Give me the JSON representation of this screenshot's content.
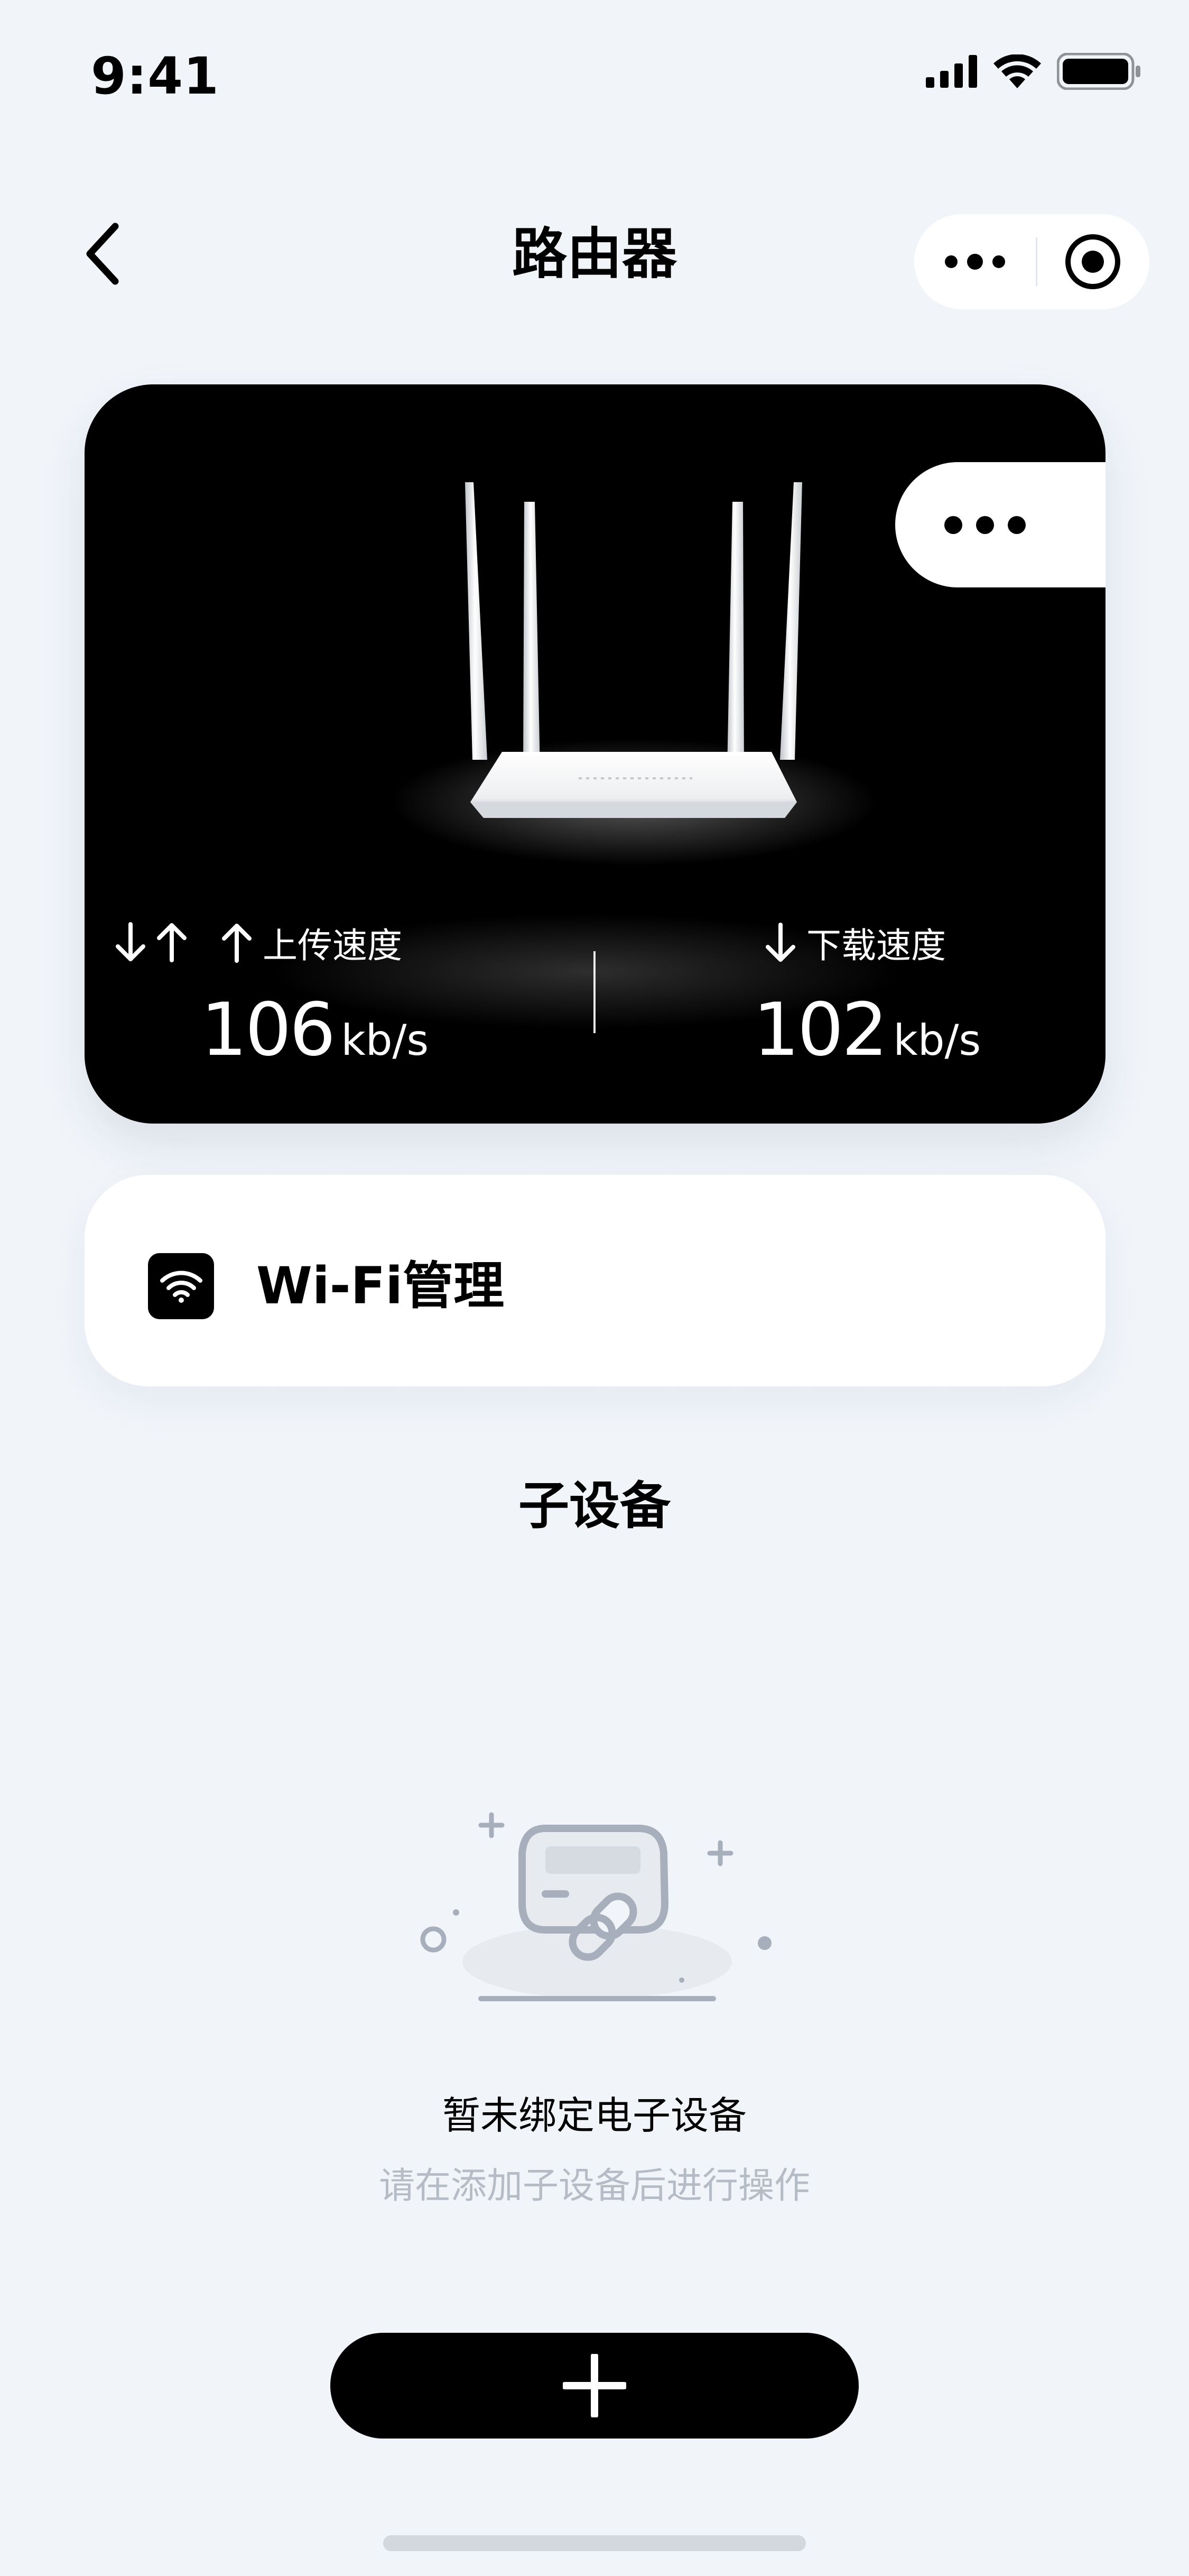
{
  "status_bar": {
    "time": "9:41",
    "icons": [
      "signal-icon",
      "wifi-icon",
      "battery-icon"
    ]
  },
  "nav": {
    "title": "路由器",
    "back_icon": "chevron-left-icon",
    "more_icon": "more-dots-icon",
    "close_icon": "record-target-icon"
  },
  "router_card": {
    "background": "#000000",
    "more_icon": "more-dots-icon",
    "transfer_icon": "down-up-arrows-icon",
    "upload": {
      "label": "上传速度",
      "value": "106",
      "unit": "kb/s",
      "icon": "arrow-up-icon"
    },
    "download": {
      "label": "下载速度",
      "value": "102",
      "unit": "kb/s",
      "icon": "arrow-down-icon"
    }
  },
  "wifi_management": {
    "label": "Wi-Fi管理",
    "icon": "wifi-icon"
  },
  "sub_devices": {
    "title": "子设备",
    "empty_icon": "device-link-icon",
    "empty_title": "暂未绑定电子设备",
    "empty_subtitle": "请在添加子设备后进行操作"
  },
  "add_button": {
    "icon": "plus-icon"
  },
  "colors": {
    "page_bg": "#F1F5FA",
    "card_dark": "#000000",
    "card_light": "#FFFFFF",
    "muted_text": "#B5BCC6",
    "illustration": "#A7AFBC"
  }
}
